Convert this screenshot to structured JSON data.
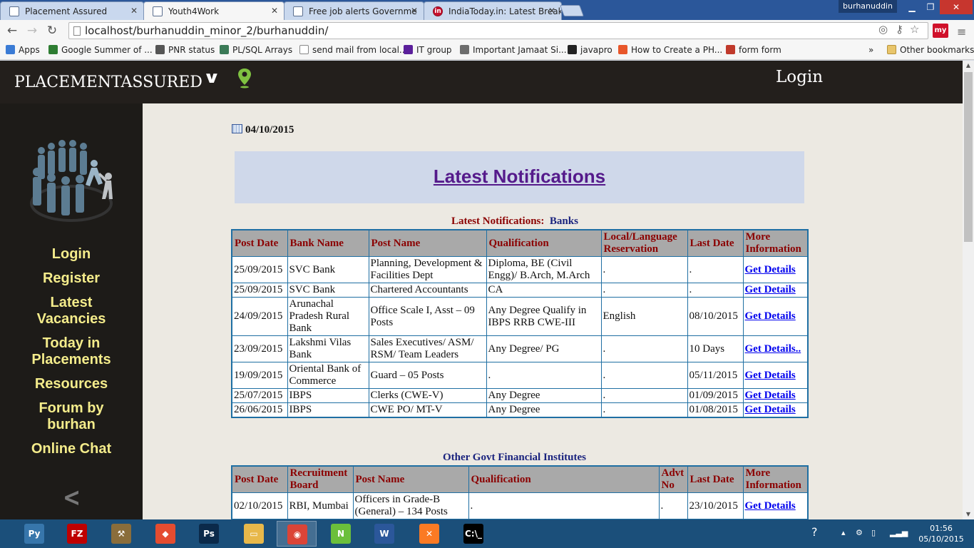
{
  "browser": {
    "tabs": [
      {
        "title": "Placement Assured",
        "active": false
      },
      {
        "title": "Youth4Work",
        "active": true
      },
      {
        "title": "Free job alerts Governme",
        "active": false
      },
      {
        "title": "IndiaToday.in: Latest Break",
        "active": false
      }
    ],
    "user": "burhanuddin",
    "url": "localhost/burhanuddin_minor_2/burhanuddin/",
    "bookmarks": [
      {
        "label": "Apps",
        "icon": "apps-grid-icon",
        "color": "#3a7bd5"
      },
      {
        "label": "Google Summer of ...",
        "icon": "gsoc-icon",
        "color": "#2e7d32"
      },
      {
        "label": "PNR status",
        "icon": "train-icon",
        "color": "#555555"
      },
      {
        "label": "PL/SQL Arrays",
        "icon": "diamond-icon",
        "color": "#3b7a57"
      },
      {
        "label": "send mail from local...",
        "icon": "page-icon",
        "color": "#ffffff"
      },
      {
        "label": "IT group",
        "icon": "yahoo-icon",
        "color": "#5b1f9b"
      },
      {
        "label": "Important Jamaat Si...",
        "icon": "dome-icon",
        "color": "#6d6d6d"
      },
      {
        "label": "javapro",
        "icon": "k-icon",
        "color": "#222222"
      },
      {
        "label": "How to Create a PH...",
        "icon": "plus-icon",
        "color": "#e8562a"
      },
      {
        "label": "form form",
        "icon": "heart-icon",
        "color": "#c0392b"
      }
    ],
    "bookmarks_overflow": "»",
    "other_bookmarks": "Other bookmarks"
  },
  "site": {
    "brand": "PLACEMENTASSURED",
    "header_login": "Login",
    "nav": [
      "Login",
      "Register",
      "Latest Vacancies",
      "Today in Placements",
      "Resources",
      "Forum by burhan",
      "Online Chat"
    ],
    "back_arrow": "<",
    "date": "04/10/2015",
    "banner_title": "Latest Notifications",
    "accent_color": "#f4ec8b"
  },
  "banks_section": {
    "caption_prefix": "Latest Notifications:",
    "caption_name": "Banks",
    "headers": [
      "Post Date",
      "Bank Name",
      "Post Name",
      "Qualification",
      "Local/Language Reservation",
      "Last Date",
      "More Information"
    ],
    "rows": [
      [
        "25/09/2015",
        "SVC Bank",
        "Planning, Development & Facilities Dept",
        "Diploma, BE (Civil Engg)/ B.Arch, M.Arch",
        ".",
        ".",
        "Get Details"
      ],
      [
        "25/09/2015",
        "SVC Bank",
        "Chartered Accountants",
        "CA",
        ".",
        ".",
        "Get Details"
      ],
      [
        "24/09/2015",
        "Arunachal Pradesh Rural Bank",
        "Office Scale I, Asst – 09 Posts",
        "Any Degree Qualify in IBPS RRB CWE-III",
        "English",
        "08/10/2015",
        "Get Details"
      ],
      [
        "23/09/2015",
        "Lakshmi Vilas Bank",
        "Sales Executives/ ASM/ RSM/ Team Leaders",
        "Any Degree/ PG",
        ".",
        "10 Days",
        "Get Details.."
      ],
      [
        "19/09/2015",
        "Oriental Bank of Commerce",
        "Guard – 05 Posts",
        ".",
        ".",
        "05/11/2015",
        "Get Details"
      ],
      [
        "25/07/2015",
        "IBPS",
        "Clerks (CWE-V)",
        "Any Degree",
        ".",
        "01/09/2015",
        "Get Details"
      ],
      [
        "26/06/2015",
        "IBPS",
        "CWE PO/ MT-V",
        "Any Degree",
        ".",
        "01/08/2015",
        "Get Details"
      ]
    ]
  },
  "govt_section": {
    "caption": "Other Govt Financial Institutes",
    "headers": [
      "Post Date",
      "Recruitment Board",
      "Post Name",
      "Qualification",
      "Advt No",
      "Last Date",
      "More Information"
    ],
    "rows": [
      [
        "02/10/2015",
        "RBI, Mumbai",
        "Officers in Grade-B (General) – 134 Posts",
        ".",
        ".",
        "23/10/2015",
        "Get Details"
      ]
    ]
  },
  "taskbar": {
    "apps": [
      {
        "name": "python-icon",
        "label": "Py",
        "color": "#3776ab"
      },
      {
        "name": "filezilla-icon",
        "label": "FZ",
        "color": "#bf0000"
      },
      {
        "name": "tools-icon",
        "label": "⚒",
        "color": "#8a6d3b"
      },
      {
        "name": "git-icon",
        "label": "◆",
        "color": "#e44c30"
      },
      {
        "name": "photoshop-icon",
        "label": "Ps",
        "color": "#0b2a4a"
      },
      {
        "name": "explorer-icon",
        "label": "▭",
        "color": "#e8b84a"
      },
      {
        "name": "chrome-icon",
        "label": "◉",
        "color": "#db4437"
      },
      {
        "name": "notepadpp-icon",
        "label": "N",
        "color": "#6bbf3b"
      },
      {
        "name": "word-icon",
        "label": "W",
        "color": "#2b579a"
      },
      {
        "name": "xampp-icon",
        "label": "✕",
        "color": "#fb7a24"
      },
      {
        "name": "cmd-icon",
        "label": "C:\\_",
        "color": "#000000"
      }
    ],
    "active_app": "chrome-icon",
    "time": "01:56",
    "date": "05/10/2015"
  }
}
